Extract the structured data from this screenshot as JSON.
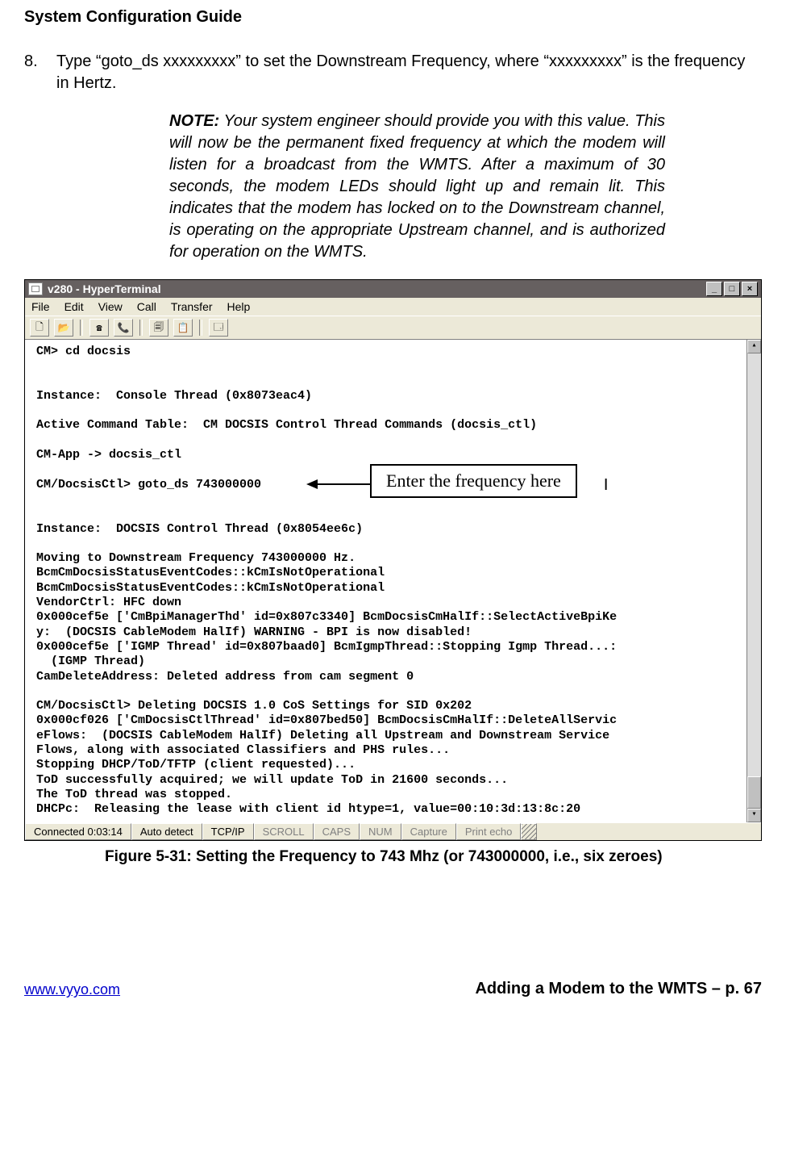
{
  "header": {
    "title": "System Configuration Guide"
  },
  "step": {
    "number": "8.",
    "text": "Type “goto_ds xxxxxxxxx” to set the Downstream Frequency, where “xxxxxxxxx” is the frequency in Hertz."
  },
  "note": {
    "label": "NOTE:",
    "text": " Your system engineer should provide you with this value. This will now be the permanent fixed frequency at which the modem will listen for a broadcast from the WMTS.  After a maximum of 30 seconds, the modem LEDs should light up and remain lit. This indicates that the modem has locked on to the Downstream channel, is operating on the appropriate Upstream channel, and is authorized for operation on the WMTS."
  },
  "terminal": {
    "title": "v280 - HyperTerminal",
    "menu": [
      "File",
      "Edit",
      "View",
      "Call",
      "Transfer",
      "Help"
    ],
    "toolbar_icons": [
      "new-file-icon",
      "open-file-icon",
      "connect-icon",
      "disconnect-icon",
      "copy-icon",
      "paste-icon",
      "properties-icon"
    ],
    "window_buttons": {
      "min": "_",
      "max": "□",
      "close": "×"
    },
    "body": "CM> cd docsis\n\n\nInstance:  Console Thread (0x8073eac4)\n\nActive Command Table:  CM DOCSIS Control Thread Commands (docsis_ctl)\n\nCM-App -> docsis_ctl\n\nCM/DocsisCtl> goto_ds 743000000                                               |\n\n\nInstance:  DOCSIS Control Thread (0x8054ee6c)\n\nMoving to Downstream Frequency 743000000 Hz.\nBcmCmDocsisStatusEventCodes::kCmIsNotOperational\nBcmCmDocsisStatusEventCodes::kCmIsNotOperational\nVendorCtrl: HFC down\n0x000cef5e ['CmBpiManagerThd' id=0x807c3340] BcmDocsisCmHalIf::SelectActiveBpiKe\ny:  (DOCSIS CableModem HalIf) WARNING - BPI is now disabled!\n0x000cef5e ['IGMP Thread' id=0x807baad0] BcmIgmpThread::Stopping Igmp Thread...:\n  (IGMP Thread)\nCamDeleteAddress: Deleted address from cam segment 0\n\nCM/DocsisCtl> Deleting DOCSIS 1.0 CoS Settings for SID 0x202\n0x000cf026 ['CmDocsisCtlThread' id=0x807bed50] BcmDocsisCmHalIf::DeleteAllServic\neFlows:  (DOCSIS CableModem HalIf) Deleting all Upstream and Downstream Service\nFlows, along with associated Classifiers and PHS rules...\nStopping DHCP/ToD/TFTP (client requested)...\nToD successfully acquired; we will update ToD in 21600 seconds...\nThe ToD thread was stopped.\nDHCPc:  Releasing the lease with client id htype=1, value=00:10:3d:13:8c:20",
    "status": {
      "connected": "Connected 0:03:14",
      "detect": "Auto detect",
      "proto": "TCP/IP",
      "scroll": "SCROLL",
      "caps": "CAPS",
      "num": "NUM",
      "capture": "Capture",
      "echo": "Print echo"
    },
    "annotation": "Enter the frequency here"
  },
  "figure_caption": "Figure 5-31: Setting the Frequency to 743 Mhz (or 743000000, i.e., six zeroes)",
  "footer": {
    "left": "www.vyyo.com",
    "right": "Adding a Modem to the WMTS – p. 67"
  }
}
